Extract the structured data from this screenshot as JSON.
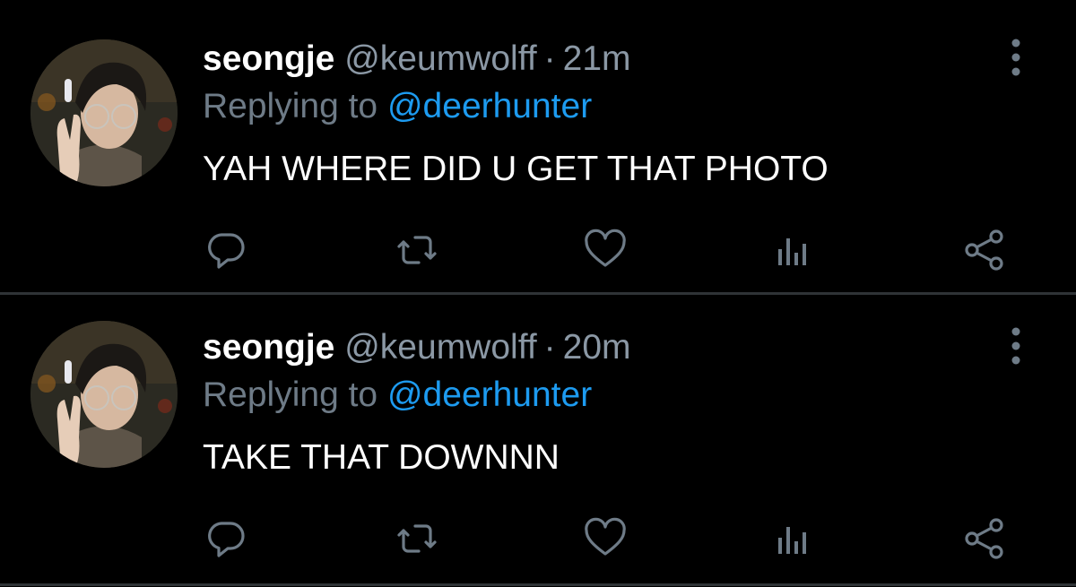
{
  "colors": {
    "background": "#000000",
    "divider": "#2f3336",
    "name": "#ffffff",
    "secondary_text": "#8b98a5",
    "mention": "#1d9bf0",
    "icon": "#6e7b87"
  },
  "tweets": [
    {
      "display_name": "seongje",
      "handle": "@keumwolff",
      "separator": "·",
      "time": "21m",
      "replying_prefix": "Replying to",
      "replying_to": "@deerhunter",
      "text": "YAH WHERE DID U GET THAT PHOTO",
      "actions": [
        "reply-icon",
        "retweet-icon",
        "like-icon",
        "views-icon",
        "share-icon"
      ]
    },
    {
      "display_name": "seongje",
      "handle": "@keumwolff",
      "separator": "·",
      "time": "20m",
      "replying_prefix": "Replying to",
      "replying_to": "@deerhunter",
      "text": "TAKE THAT DOWNNN",
      "actions": [
        "reply-icon",
        "retweet-icon",
        "like-icon",
        "views-icon",
        "share-icon"
      ]
    }
  ]
}
